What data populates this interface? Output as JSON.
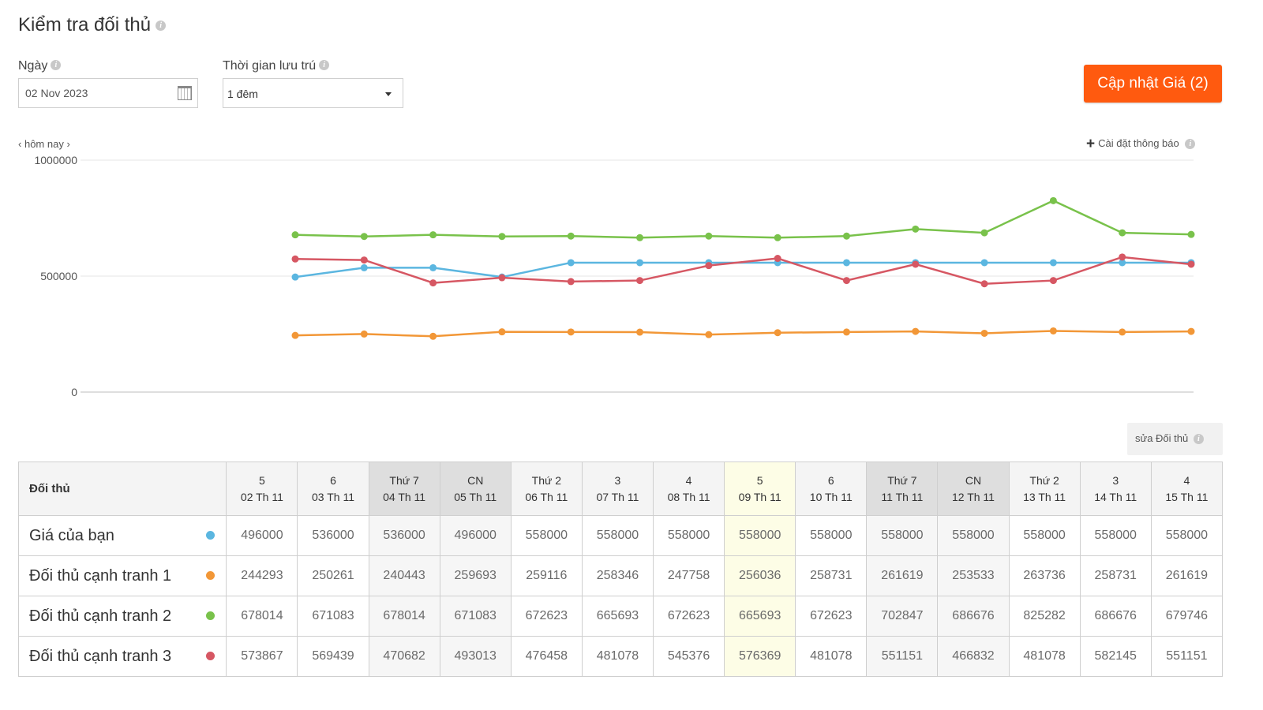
{
  "page": {
    "title": "Kiểm tra đối thủ"
  },
  "filters": {
    "date_label": "Ngày",
    "date_value": "02 Nov 2023",
    "stay_label": "Thời gian lưu trú",
    "stay_value": "1 đêm"
  },
  "update_button": {
    "label": "Cập nhật Giá (2)"
  },
  "nav": {
    "today_label": "hôm nay"
  },
  "notify": {
    "label": "Cài đặt thông báo"
  },
  "edit_competitors": {
    "label": "sửa Đối thủ"
  },
  "colors": {
    "you": "#5bb6e0",
    "c1": "#f29737",
    "c2": "#79c24b",
    "c3": "#d65763",
    "button": "#ff5a0f"
  },
  "chart_data": {
    "type": "line",
    "ylim": [
      0,
      1000000
    ],
    "yticks": [
      "1000000",
      "500000",
      "0"
    ],
    "grid": true,
    "x": [
      "02 Th 11",
      "03 Th 11",
      "04 Th 11",
      "05 Th 11",
      "06 Th 11",
      "07 Th 11",
      "08 Th 11",
      "09 Th 11",
      "10 Th 11",
      "11 Th 11",
      "12 Th 11",
      "13 Th 11",
      "14 Th 11",
      "15 Th 11"
    ],
    "series": [
      {
        "name": "Giá của bạn",
        "color": "#5bb6e0",
        "values": [
          496000,
          536000,
          536000,
          496000,
          558000,
          558000,
          558000,
          558000,
          558000,
          558000,
          558000,
          558000,
          558000,
          558000
        ]
      },
      {
        "name": "Đối thủ cạnh tranh 1",
        "color": "#f29737",
        "values": [
          244293,
          250261,
          240443,
          259693,
          259116,
          258346,
          247758,
          256036,
          258731,
          261619,
          253533,
          263736,
          258731,
          261619
        ]
      },
      {
        "name": "Đối thủ cạnh tranh 2",
        "color": "#79c24b",
        "values": [
          678014,
          671083,
          678014,
          671083,
          672623,
          665693,
          672623,
          665693,
          672623,
          702847,
          686676,
          825282,
          686676,
          679746
        ]
      },
      {
        "name": "Đối thủ cạnh tranh 3",
        "color": "#d65763",
        "values": [
          573867,
          569439,
          470682,
          493013,
          476458,
          481078,
          545376,
          576369,
          481078,
          551151,
          466832,
          481078,
          582145,
          551151
        ]
      }
    ]
  },
  "table": {
    "header_label": "Đối thủ",
    "columns": [
      {
        "day": "5",
        "date": "02 Th 11",
        "weekend": false,
        "today": false
      },
      {
        "day": "6",
        "date": "03 Th 11",
        "weekend": false,
        "today": false
      },
      {
        "day": "Thứ 7",
        "date": "04 Th 11",
        "weekend": true,
        "today": false
      },
      {
        "day": "CN",
        "date": "05 Th 11",
        "weekend": true,
        "today": false
      },
      {
        "day": "Thứ 2",
        "date": "06 Th 11",
        "weekend": false,
        "today": false
      },
      {
        "day": "3",
        "date": "07 Th 11",
        "weekend": false,
        "today": false
      },
      {
        "day": "4",
        "date": "08 Th 11",
        "weekend": false,
        "today": false
      },
      {
        "day": "5",
        "date": "09 Th 11",
        "weekend": false,
        "today": true
      },
      {
        "day": "6",
        "date": "10 Th 11",
        "weekend": false,
        "today": false
      },
      {
        "day": "Thứ 7",
        "date": "11 Th 11",
        "weekend": true,
        "today": false
      },
      {
        "day": "CN",
        "date": "12 Th 11",
        "weekend": true,
        "today": false
      },
      {
        "day": "Thứ 2",
        "date": "13 Th 11",
        "weekend": false,
        "today": false
      },
      {
        "day": "3",
        "date": "14 Th 11",
        "weekend": false,
        "today": false
      },
      {
        "day": "4",
        "date": "15 Th 11",
        "weekend": false,
        "today": false
      }
    ],
    "rows": [
      {
        "name": "Giá của bạn",
        "color": "#5bb6e0",
        "values": [
          "496000",
          "536000",
          "536000",
          "496000",
          "558000",
          "558000",
          "558000",
          "558000",
          "558000",
          "558000",
          "558000",
          "558000",
          "558000",
          "558000"
        ]
      },
      {
        "name": "Đối thủ cạnh tranh 1",
        "color": "#f29737",
        "values": [
          "244293",
          "250261",
          "240443",
          "259693",
          "259116",
          "258346",
          "247758",
          "256036",
          "258731",
          "261619",
          "253533",
          "263736",
          "258731",
          "261619"
        ]
      },
      {
        "name": "Đối thủ cạnh tranh 2",
        "color": "#79c24b",
        "values": [
          "678014",
          "671083",
          "678014",
          "671083",
          "672623",
          "665693",
          "672623",
          "665693",
          "672623",
          "702847",
          "686676",
          "825282",
          "686676",
          "679746"
        ]
      },
      {
        "name": "Đối thủ cạnh tranh 3",
        "color": "#d65763",
        "values": [
          "573867",
          "569439",
          "470682",
          "493013",
          "476458",
          "481078",
          "545376",
          "576369",
          "481078",
          "551151",
          "466832",
          "481078",
          "582145",
          "551151"
        ]
      }
    ]
  }
}
